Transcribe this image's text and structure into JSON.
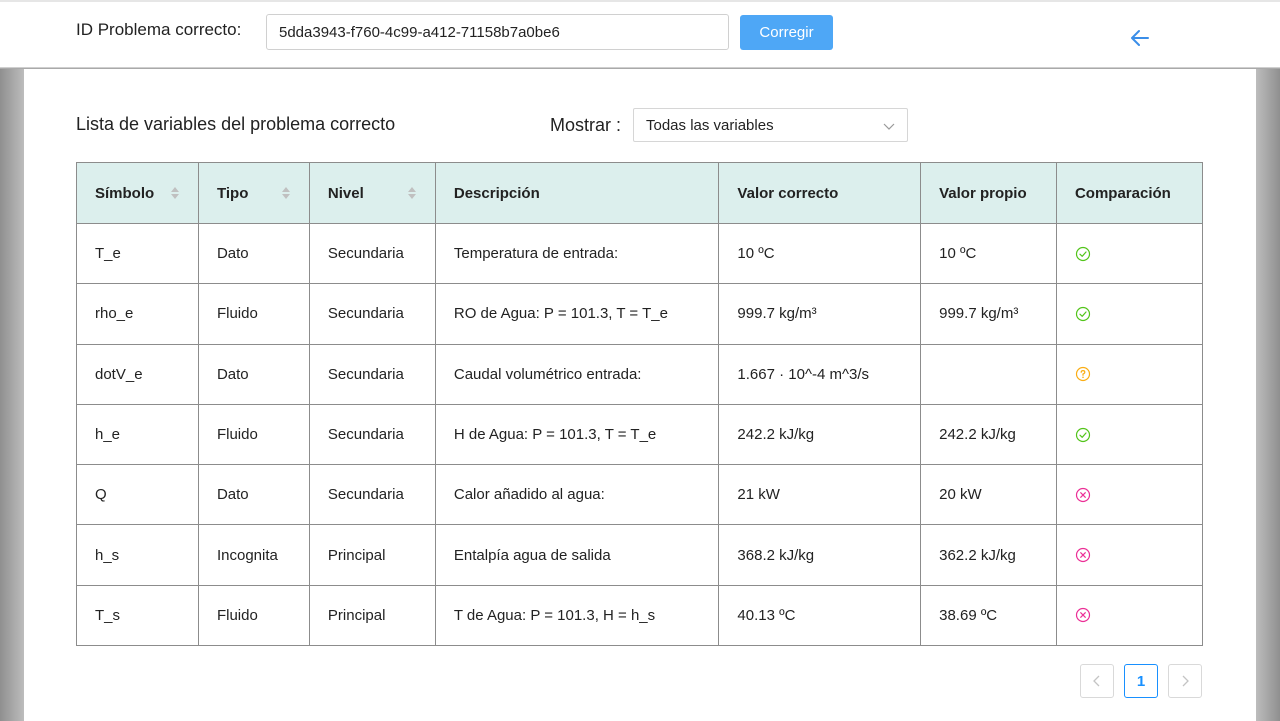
{
  "header": {
    "id_label": "ID Problema correcto:",
    "id_value": "5dda3943-f760-4c99-a412-71158b7a0be6",
    "fix_button": "Corregir",
    "back_icon": "arrow-left-icon"
  },
  "panel": {
    "title": "Lista de variables del problema correcto",
    "show_label": "Mostrar :",
    "show_selected": "Todas las variables"
  },
  "table": {
    "columns": [
      "Símbolo",
      "Tipo",
      "Nivel",
      "Descripción",
      "Valor correcto",
      "Valor propio",
      "Comparación"
    ],
    "rows": [
      {
        "symbol": "T_e",
        "type": "Dato",
        "level": "Secundaria",
        "description": "Temperatura de entrada:",
        "correct": "10 ºC",
        "own": "10 ºC",
        "status": "ok"
      },
      {
        "symbol": "rho_e",
        "type": "Fluido",
        "level": "Secundaria",
        "description": "RO de Agua: P = 101.3, T = T_e",
        "correct": "999.7 kg/m³",
        "own": "999.7 kg/m³",
        "status": "ok"
      },
      {
        "symbol": "dotV_e",
        "type": "Dato",
        "level": "Secundaria",
        "description": "Caudal volumétrico entrada:",
        "correct": "1.667 · 10^-4 m^3/s",
        "own": "",
        "status": "unknown"
      },
      {
        "symbol": "h_e",
        "type": "Fluido",
        "level": "Secundaria",
        "description": "H de Agua: P = 101.3, T = T_e",
        "correct": "242.2 kJ/kg",
        "own": "242.2 kJ/kg",
        "status": "ok"
      },
      {
        "symbol": "Q",
        "type": "Dato",
        "level": "Secundaria",
        "description": "Calor añadido al agua:",
        "correct": "21 kW",
        "own": "20 kW",
        "status": "wrong"
      },
      {
        "symbol": "h_s",
        "type": "Incognita",
        "level": "Principal",
        "description": "Entalpía agua de salida",
        "correct": "368.2 kJ/kg",
        "own": "362.2 kJ/kg",
        "status": "wrong"
      },
      {
        "symbol": "T_s",
        "type": "Fluido",
        "level": "Principal",
        "description": "T de Agua: P = 101.3, H = h_s",
        "correct": "40.13 ºC",
        "own": "38.69 ºC",
        "status": "wrong"
      }
    ]
  },
  "pagination": {
    "current_page": "1",
    "prev_icon": "chevron-left-icon",
    "next_icon": "chevron-right-icon"
  },
  "colors": {
    "primary": "#4ea7f6",
    "header_bg": "#dcefed",
    "ok": "#52c41a",
    "unknown": "#faad14",
    "wrong": "#eb2f96"
  }
}
